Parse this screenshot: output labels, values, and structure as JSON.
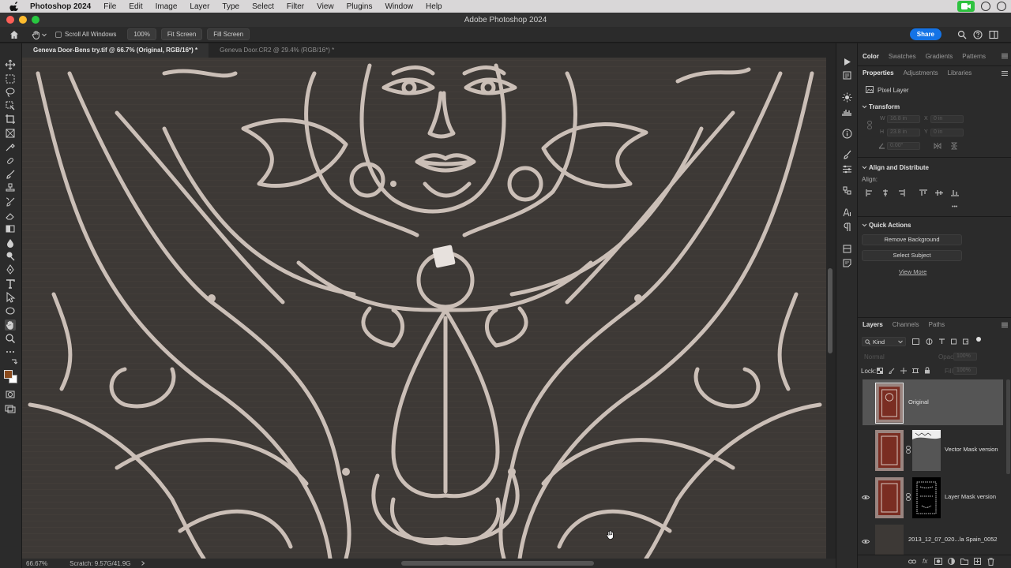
{
  "menubar": {
    "app_name": "Photoshop 2024",
    "items": [
      "File",
      "Edit",
      "Image",
      "Layer",
      "Type",
      "Select",
      "Filter",
      "View",
      "Plugins",
      "Window",
      "Help"
    ]
  },
  "window": {
    "title": "Adobe Photoshop 2024"
  },
  "options": {
    "scroll_all_label": "Scroll All Windows",
    "zoom_button": "100%",
    "fit_screen": "Fit Screen",
    "fill_screen": "Fill Screen",
    "share_label": "Share"
  },
  "tabs": [
    {
      "label": "Geneva Door-Bens try.tif @ 66.7% (Original, RGB/16*) *"
    },
    {
      "label": "Geneva Door.CR2 @ 29.4% (RGB/16*) *"
    }
  ],
  "status": {
    "zoom": "66.67%",
    "scratch": "Scratch: 9.57G/41.9G"
  },
  "panels": {
    "top_tabs": [
      "Color",
      "Swatches",
      "Gradients",
      "Patterns"
    ],
    "prop_tabs": [
      "Properties",
      "Adjustments",
      "Libraries"
    ],
    "layer_type": "Pixel Layer",
    "transform": {
      "title": "Transform",
      "w_label": "W",
      "w_value": "16.8 in",
      "h_label": "H",
      "h_value": "23.8 in",
      "x_label": "X",
      "x_value": "0 in",
      "y_label": "Y",
      "y_value": "0 in",
      "angle_value": "0.00°"
    },
    "align": {
      "title": "Align and Distribute",
      "label": "Align:",
      "more": "•••"
    },
    "quick_actions": {
      "title": "Quick Actions",
      "remove_bg": "Remove Background",
      "select_subject": "Select Subject",
      "view_more": "View More"
    },
    "layers_tabs": [
      "Layers",
      "Channels",
      "Paths"
    ],
    "kind_filter": "Kind",
    "blend_mode": "Normal",
    "opacity_label": "Opacity:",
    "opacity_value": "100%",
    "lock_label": "Lock:",
    "fill_label": "Fill:",
    "fill_value": "100%",
    "layers": [
      {
        "name": "Original",
        "visible": false,
        "selected": true
      },
      {
        "name": "Vector Mask version",
        "visible": false,
        "selected": false
      },
      {
        "name": "Layer Mask version",
        "visible": true,
        "selected": false
      },
      {
        "name": "2013_12_07_020...la Spain_0052",
        "visible": true,
        "selected": false
      }
    ],
    "footer_icons": [
      "link-icon",
      "fx-icon",
      "mask-icon",
      "adjustment-icon",
      "folder-icon",
      "new-layer-icon",
      "trash-icon"
    ]
  },
  "colors": {
    "foreground": "#8a4a1c",
    "background": "#ffffff",
    "accent": "#1473e6",
    "canvas": "#3d3936"
  }
}
